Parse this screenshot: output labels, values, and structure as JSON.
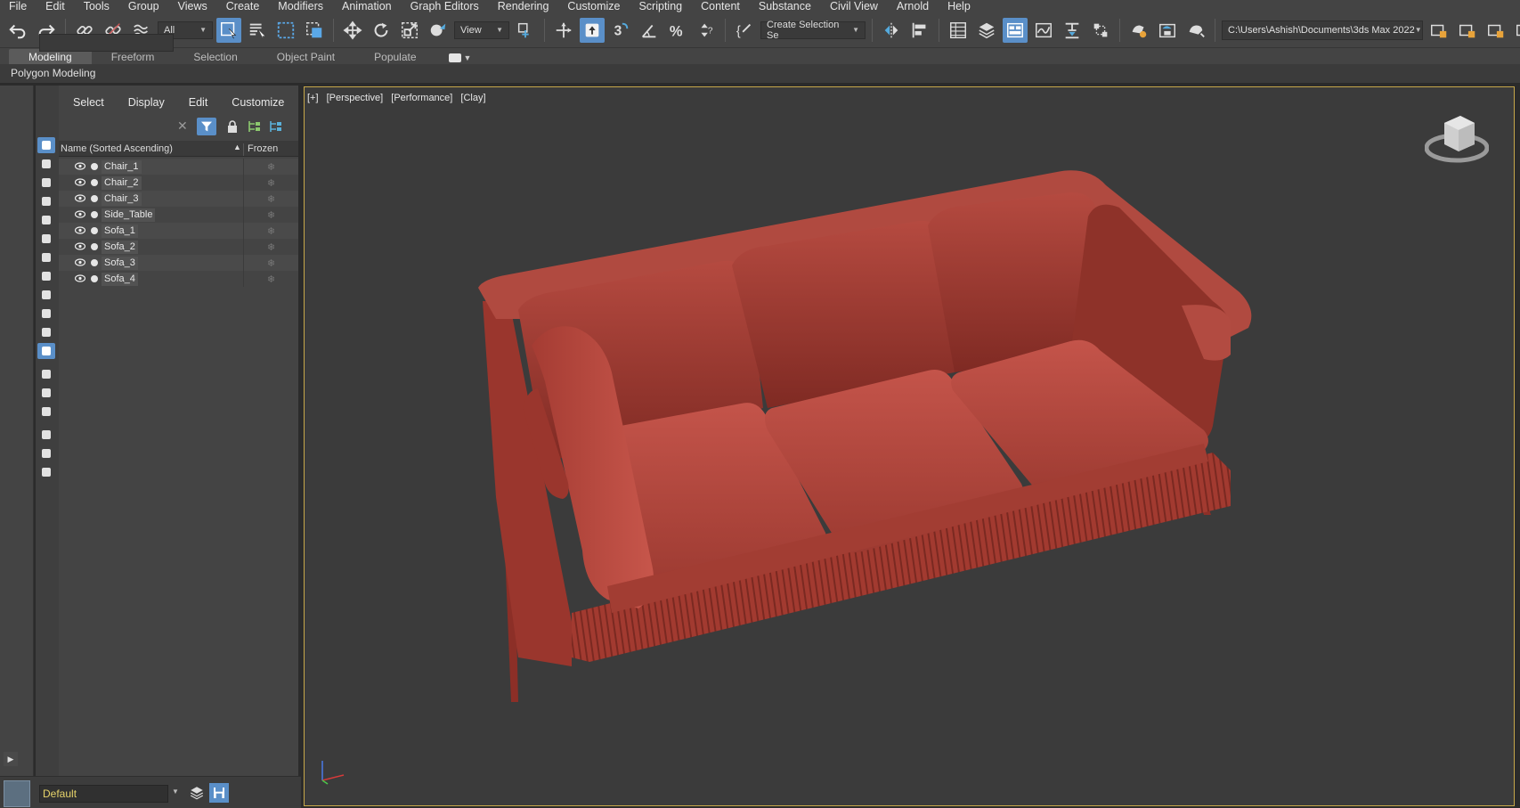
{
  "menu": [
    "File",
    "Edit",
    "Tools",
    "Group",
    "Views",
    "Create",
    "Modifiers",
    "Animation",
    "Graph Editors",
    "Rendering",
    "Customize",
    "Scripting",
    "Content",
    "Substance",
    "Civil View",
    "Arnold",
    "Help"
  ],
  "toolbar": {
    "selection_filter": "All",
    "ref_coord": "View",
    "named_selection": "Create Selection Se",
    "project_path": "C:\\Users\\Ashish\\Documents\\3ds Max 2022"
  },
  "ribbon": {
    "tabs": [
      "Modeling",
      "Freeform",
      "Selection",
      "Object Paint",
      "Populate"
    ],
    "active": "Modeling",
    "panel_label": "Polygon Modeling"
  },
  "explorer": {
    "menu": [
      "Select",
      "Display",
      "Edit",
      "Customize"
    ],
    "search_value": "",
    "col_name": "Name (Sorted Ascending)",
    "col_frozen": "Frozen",
    "sort_indicator": "▲",
    "frozen_glyph": "❄",
    "objects": [
      "Chair_1",
      "Chair_2",
      "Chair_3",
      "Side_Table",
      "Sofa_1",
      "Sofa_2",
      "Sofa_3",
      "Sofa_4"
    ]
  },
  "layer": {
    "name": "Default"
  },
  "viewport": {
    "labels": [
      "[+]",
      "[Perspective]",
      "[Performance]",
      "[Clay]"
    ],
    "clay_color": "#b2463a",
    "border_color": "#c7a84a"
  },
  "icons": {
    "undo": "undo-icon",
    "redo": "redo-icon",
    "link": "link-icon",
    "unlink": "unlink-icon",
    "move": "move-icon",
    "rotate": "rotate-icon",
    "scale": "scale-icon"
  }
}
